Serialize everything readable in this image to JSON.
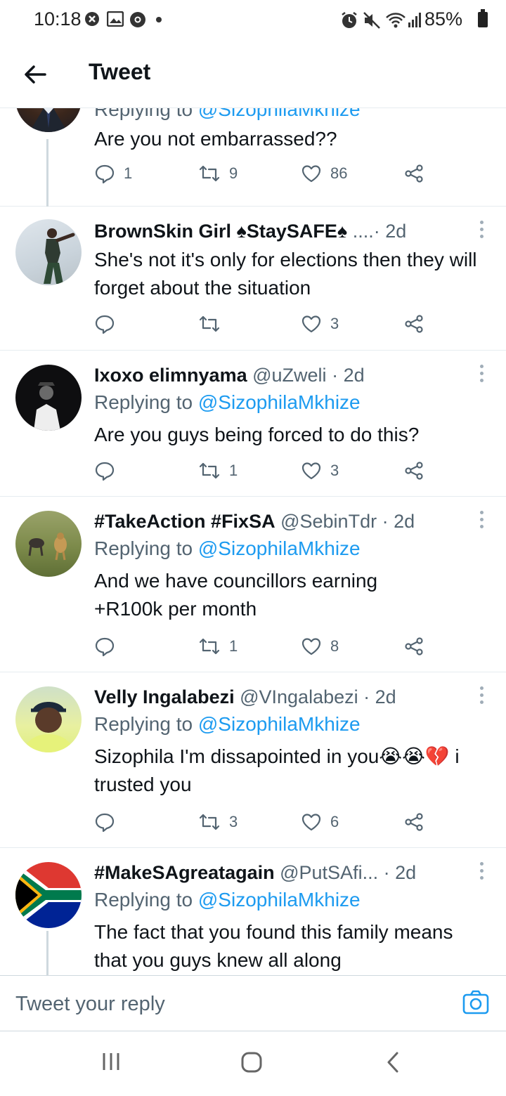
{
  "status_bar": {
    "time": "10:18",
    "battery": "85%"
  },
  "header": {
    "title": "Tweet"
  },
  "tweets": [
    {
      "replying_prefix": "Replying to ",
      "replying_handle": "@SizophilaMkhize",
      "text": "Are you not embarrassed??",
      "reply_count": "1",
      "retweet_count": "9",
      "like_count": "86"
    },
    {
      "name": "BrownSkin Girl ♠StaySAFE♠",
      "handle": "....",
      "time": "· 2d",
      "text": "She's not it's only for elections then they will forget about the situation",
      "reply_count": "",
      "retweet_count": "",
      "like_count": "3"
    },
    {
      "name": "Ixoxo elimnyama",
      "handle": "@uZweli",
      "time": "· 2d",
      "replying_prefix": "Replying to ",
      "replying_handle": "@SizophilaMkhize",
      "text": "Are you guys being forced to do this?",
      "reply_count": "",
      "retweet_count": "1",
      "like_count": "3"
    },
    {
      "name": "#TakeAction #FixSA",
      "handle": "@SebinTdr",
      "time": "· 2d",
      "replying_prefix": "Replying to ",
      "replying_handle": "@SizophilaMkhize",
      "text": "And we have councillors  earning +R100k per month",
      "reply_count": "",
      "retweet_count": "1",
      "like_count": "8"
    },
    {
      "name": "Velly Ingalabezi",
      "handle": "@VIngalabezi",
      "time": "· 2d",
      "replying_prefix": "Replying to ",
      "replying_handle": "@SizophilaMkhize",
      "text": "Sizophila I'm dissapointed in you😭😭💔 i trusted you",
      "reply_count": "",
      "retweet_count": "3",
      "like_count": "6"
    },
    {
      "name": "#MakeSAgreatagain",
      "handle": "@PutSAfi...",
      "time": "· 2d",
      "replying_prefix": "Replying to ",
      "replying_handle": "@SizophilaMkhize",
      "text": "The fact that you found this family means that you guys knew all along"
    }
  ],
  "reply_bar": {
    "placeholder": "Tweet your reply"
  },
  "colors": {
    "link": "#1d9bf0",
    "muted": "#536471",
    "divider": "#e6ecf0"
  },
  "icons": [
    "back-arrow-icon",
    "reply-icon",
    "retweet-icon",
    "like-icon",
    "share-icon",
    "more-icon",
    "camera-icon"
  ]
}
